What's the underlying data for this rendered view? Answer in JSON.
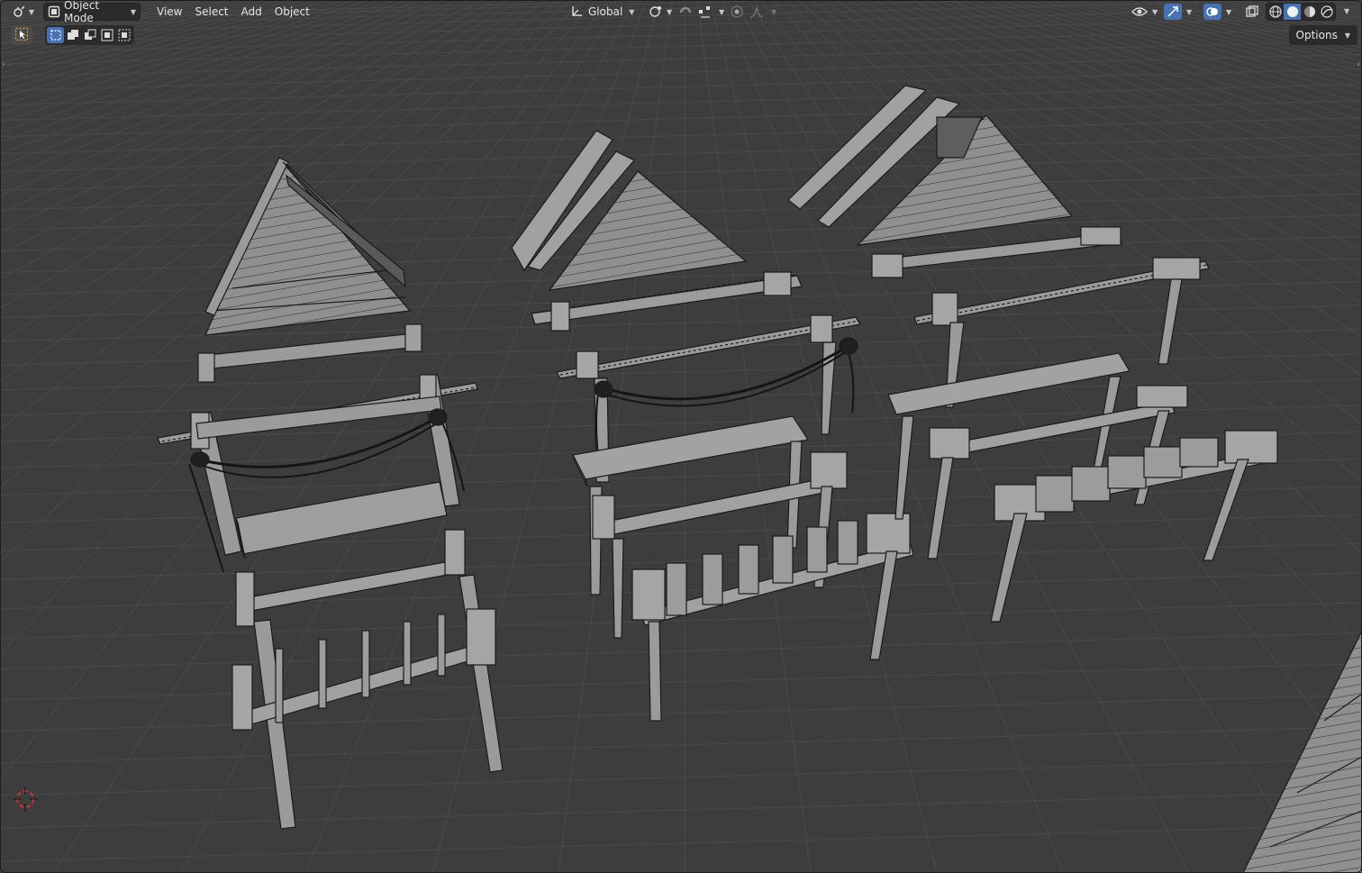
{
  "header": {
    "editor_type_icon": "viewport-editor-icon",
    "mode_label": "Object Mode",
    "menus": [
      "View",
      "Select",
      "Add",
      "Object"
    ],
    "orientation_label": "Global",
    "pivot_icon": "pivot-icon",
    "snap_icon": "snap-magnet-icon",
    "proportional_icon": "proportional-edit-icon"
  },
  "toolbar": {
    "select_modes": [
      "new",
      "extend",
      "subtract",
      "intersect"
    ],
    "options_label": "Options"
  },
  "colors": {
    "accent": "#4772b3",
    "background": "#3d3d3d",
    "grid": "#4a4a4a",
    "mesh_fill": "#8a8a8a",
    "mesh_wire": "#1e1e1e",
    "cursor_red": "#d23232"
  },
  "viewport": {
    "shading_active": "solid",
    "objects": [
      "stall-left",
      "stall-middle",
      "stall-right"
    ]
  }
}
